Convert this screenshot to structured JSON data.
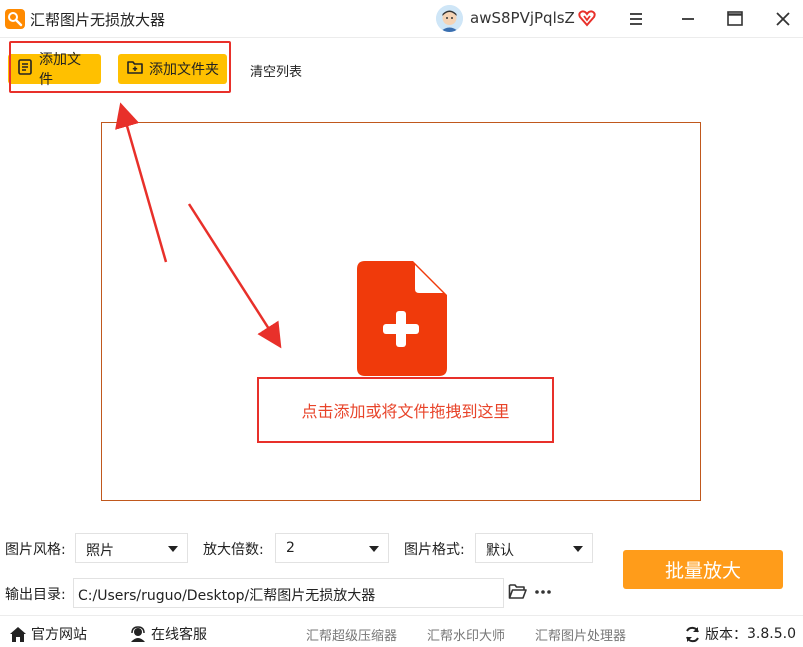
{
  "window": {
    "title": "汇帮图片无损放大器",
    "username": "awS8PVjPqlsZ"
  },
  "toolbar": {
    "add_file": "添加文件",
    "add_folder": "添加文件夹",
    "clear_list": "清空列表"
  },
  "dropzone": {
    "hint": "点击添加或将文件拖拽到这里"
  },
  "settings": {
    "style_label": "图片风格:",
    "style_value": "照片",
    "scale_label": "放大倍数:",
    "scale_value": "2",
    "format_label": "图片格式:",
    "format_value": "默认",
    "output_label": "输出目录:",
    "output_path": "C:/Users/ruguo/Desktop/汇帮图片无损放大器",
    "batch_button": "批量放大"
  },
  "footer": {
    "official_site": "官方网站",
    "online_service": "在线客服",
    "link1": "汇帮超级压缩器",
    "link2": "汇帮水印大师",
    "link3": "汇帮图片处理器",
    "version_label": "版本：",
    "version_value": "3.8.5.0"
  },
  "colors": {
    "accent_yellow": "#ffc000",
    "accent_orange": "#ff9c1a",
    "highlight_red": "#e8302a",
    "file_icon_red": "#f03a0b"
  }
}
